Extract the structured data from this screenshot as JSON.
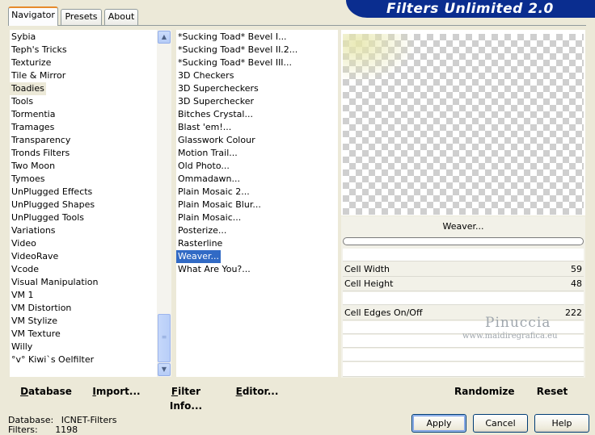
{
  "app": {
    "title": "Filters Unlimited 2.0",
    "tabs": [
      {
        "label": "Navigator",
        "active": true
      },
      {
        "label": "Presets",
        "active": false
      },
      {
        "label": "About",
        "active": false
      }
    ]
  },
  "categories": {
    "items": [
      "Sybia",
      "Teph's Tricks",
      "Texturize",
      "Tile & Mirror",
      "Toadies",
      "Tools",
      "Tormentia",
      "Tramages",
      "Transparency",
      "Tronds Filters",
      "Two Moon",
      "Tymoes",
      "UnPlugged Effects",
      "UnPlugged Shapes",
      "UnPlugged Tools",
      "Variations",
      "Video",
      "VideoRave",
      "Vcode",
      "Visual Manipulation",
      "VM 1",
      "VM Distortion",
      "VM Stylize",
      "VM Texture",
      "Willy",
      "°v° Kiwi`s Oelfilter"
    ],
    "selected": "Toadies"
  },
  "filters": {
    "items": [
      "*Sucking Toad*  Bevel I...",
      "*Sucking Toad*  Bevel II.2...",
      "*Sucking Toad*  Bevel III...",
      "3D Checkers",
      "3D Supercheckers",
      "3D Superchecker",
      "Bitches Crystal...",
      "Blast 'em!...",
      "Glasswork Colour",
      "Motion Trail...",
      "Old Photo...",
      "Ommadawn...",
      "Plain Mosaic 2...",
      "Plain Mosaic Blur...",
      "Plain Mosaic...",
      "Posterize...",
      "Rasterline",
      "Weaver...",
      "What Are You?..."
    ],
    "selected": "Weaver..."
  },
  "panel": {
    "filter_name": "Weaver...",
    "progress": 0,
    "params": [
      {
        "label": "Cell Width",
        "value": "59"
      },
      {
        "label": "Cell Height",
        "value": "48"
      },
      {
        "label": "Cell Edges On/Off",
        "value": "222"
      }
    ],
    "watermark_name": "Pinuccia",
    "watermark_url": "www.maidiregrafica.eu"
  },
  "toolbar": {
    "database": "Database",
    "import": "Import...",
    "filter_info": "Filter Info...",
    "editor": "Editor...",
    "randomize": "Randomize",
    "reset": "Reset"
  },
  "status": {
    "database_label": "Database:",
    "database_value": "ICNET-Filters",
    "filters_label": "Filters:",
    "filters_value": "1198"
  },
  "dialog": {
    "apply": "Apply",
    "cancel": "Cancel",
    "help": "Help"
  },
  "colors": {
    "banner": "#0a2d8f",
    "selection": "#316ac5",
    "window_bg": "#ece9d8"
  }
}
